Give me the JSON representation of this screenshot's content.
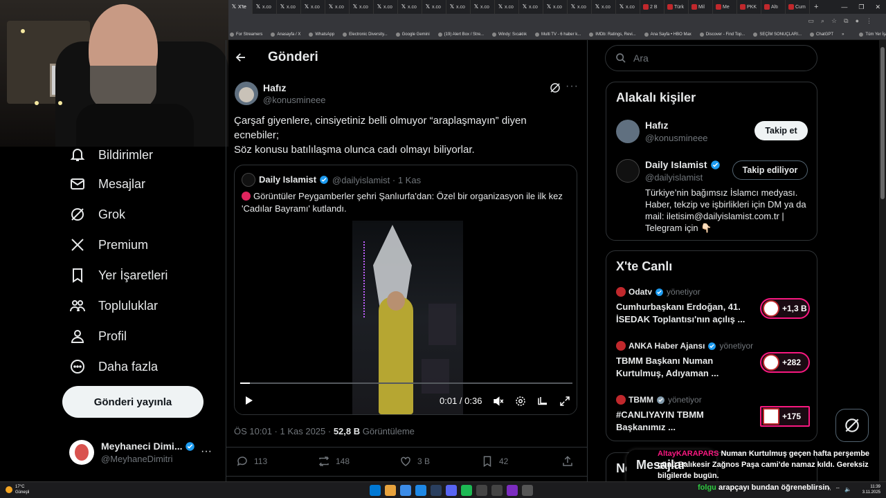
{
  "browser": {
    "tabs": [
      "X'te",
      "x.co",
      "x.co",
      "x.co",
      "x.co",
      "x.co",
      "x.co",
      "x.co",
      "x.co",
      "x.co",
      "x.co",
      "x.co",
      "x.co",
      "x.co",
      "x.co",
      "x.co",
      "x.co",
      "2 B",
      "Türk",
      "Mil",
      "Me",
      "PKK",
      "Altı",
      "Cum"
    ],
    "new_tab": "+",
    "bookmarks": [
      "For Streamers",
      "Anasayfa / X",
      "WhatsApp",
      "Electronic Diversity...",
      "Google Gemini",
      "(19) Alert Box / Stre...",
      "Windy: Sıcaklık",
      "Multi TV - 6 haber k...",
      "IMDb: Ratings, Revi...",
      "Ana Sayfa • HBO Max",
      "Discover - Find Top...",
      "SEÇİM SONUÇLARI...",
      "ChatGPT",
      "»",
      "Tüm Yer İşaretleri"
    ]
  },
  "nav": {
    "items": [
      {
        "label": "Bildirimler",
        "icon": "bell-icon"
      },
      {
        "label": "Mesajlar",
        "icon": "mail-icon"
      },
      {
        "label": "Grok",
        "icon": "grok-icon"
      },
      {
        "label": "Premium",
        "icon": "x-logo-icon"
      },
      {
        "label": "Yer İşaretleri",
        "icon": "bookmark-icon"
      },
      {
        "label": "Topluluklar",
        "icon": "communities-icon"
      },
      {
        "label": "Profil",
        "icon": "profile-icon"
      },
      {
        "label": "Daha fazla",
        "icon": "more-circle-icon"
      }
    ],
    "post_button": "Gönderi yayınla",
    "account": {
      "name": "Meyhaneci Dimi...",
      "handle": "@MeyhaneDimitri",
      "more": "···"
    }
  },
  "main": {
    "header_title": "Gönderi",
    "tweet": {
      "name": "Hafız",
      "handle": "@konusmineee",
      "text_line1": "Çarşaf giyenlere, cinsiyetiniz belli olmuyor “araplaşmayın” diyen ecnebiler;",
      "text_line2": "Söz konusu batılılaşma olunca cadı olmayı biliyorlar.",
      "quote": {
        "name": "Daily Islamist",
        "handle": "@dailyislamist · 1 Kas",
        "text": "Görüntüler Peygamberler şehri Şanlıurfa'dan: Özel bir organizasyon ile ilk kez 'Cadılar Bayramı' kutlandı.",
        "video_time": "0:01 / 0:36",
        "video_progress": 0.03
      },
      "meta_time": "ÖS 10:01 · 1 Kas 2025 · ",
      "views_count": "52,8 B",
      "views_label": " Görüntüleme",
      "replies": "113",
      "reposts": "148",
      "likes": "3 B",
      "bookmarks": "42"
    }
  },
  "right": {
    "search_placeholder": "Ara",
    "related_title": "Alakalı kişiler",
    "people": [
      {
        "name": "Hafız",
        "handle": "@konusmineee",
        "button": "Takip et",
        "bio": ""
      },
      {
        "name": "Daily Islamist",
        "handle": "@dailyislamist",
        "button": "Takip ediliyor",
        "bio": "Türkiye’nin bağımsız İslamcı medyası. Haber, tekzip ve işbirlikleri için DM ya da mail: iletisim@dailyislamist.com.tr | Telegram için 👇🏻"
      }
    ],
    "live_title": "X'te Canlı",
    "live": [
      {
        "host": "Odatv",
        "role": "yönetiyor",
        "title": "Cumhurbaşkanı Erdoğan, 41. İSEDAK Toplantısı'nın açılış ...",
        "count": "+1,3 B"
      },
      {
        "host": "ANKA Haber Ajansı",
        "role": "yönetiyor",
        "title": "TBMM Başkanı Numan Kurtulmuş, Adıyaman ...",
        "count": "+282"
      },
      {
        "host": "TBMM",
        "role": "yönetiyor",
        "title": "#CANLIYAYIN  TBMM Başkanımız ...",
        "count": "+175"
      }
    ],
    "messages_label": "Mesajlar",
    "next_panel_peek": "Ne"
  },
  "stream_chat": {
    "user1": "AltayKARAPARS",
    "msg1": "Numan Kurtulmuş geçen hafta perşembe günü Balıkesir Zağnos Paşa cami'de namaz kıldı. Gereksiz bilgilerde bugün.",
    "user2": "folgu",
    "msg2": "arapçayı bundan öğreneblirsin"
  },
  "taskbar": {
    "temp": "17°C",
    "weather": "Güneşli",
    "time": "11:39",
    "date": "3.11.2025"
  },
  "colors": {
    "accent_verified": "#1d9bf0",
    "live_pink": "#f91880",
    "background": "#000000",
    "border": "#2f3336"
  }
}
